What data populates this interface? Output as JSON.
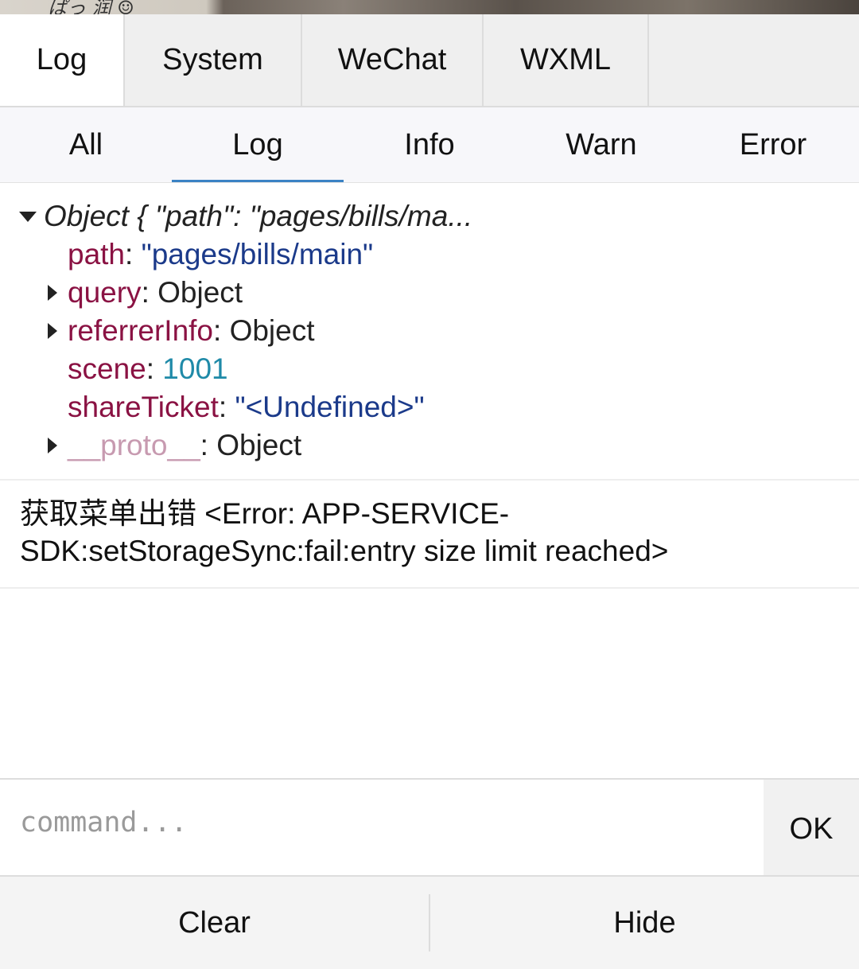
{
  "main_tabs": [
    {
      "label": "Log",
      "active": true
    },
    {
      "label": "System",
      "active": false
    },
    {
      "label": "WeChat",
      "active": false
    },
    {
      "label": "WXML",
      "active": false
    }
  ],
  "filter_tabs": [
    {
      "label": "All",
      "active": false
    },
    {
      "label": "Log",
      "active": true
    },
    {
      "label": "Info",
      "active": false
    },
    {
      "label": "Warn",
      "active": false
    },
    {
      "label": "Error",
      "active": false
    }
  ],
  "log": {
    "object_entry": {
      "summary": "Object { \"path\": \"pages/bills/ma...",
      "properties": [
        {
          "key": "path",
          "value": "\"pages/bills/main\""
        },
        {
          "key": "query",
          "value": "Object"
        },
        {
          "key": "referrerInfo",
          "value": "Object"
        },
        {
          "key": "scene",
          "value": "1001"
        },
        {
          "key": "shareTicket",
          "value": "\"<Undefined>\""
        },
        {
          "key": "__proto__",
          "value": "Object"
        }
      ],
      "separator": ": "
    },
    "error_entry": {
      "text": "获取菜单出错 <Error: APP-SERVICE-SDK:setStorageSync:fail:entry size limit reached>"
    }
  },
  "command": {
    "placeholder": "command...",
    "value": "",
    "ok_label": "OK"
  },
  "footer": {
    "clear_label": "Clear",
    "hide_label": "Hide"
  },
  "colors": {
    "key": "#8a1243",
    "string": "#1b3a8a",
    "number": "#1f8aa8",
    "active_tab_underline": "#3b82c4"
  }
}
